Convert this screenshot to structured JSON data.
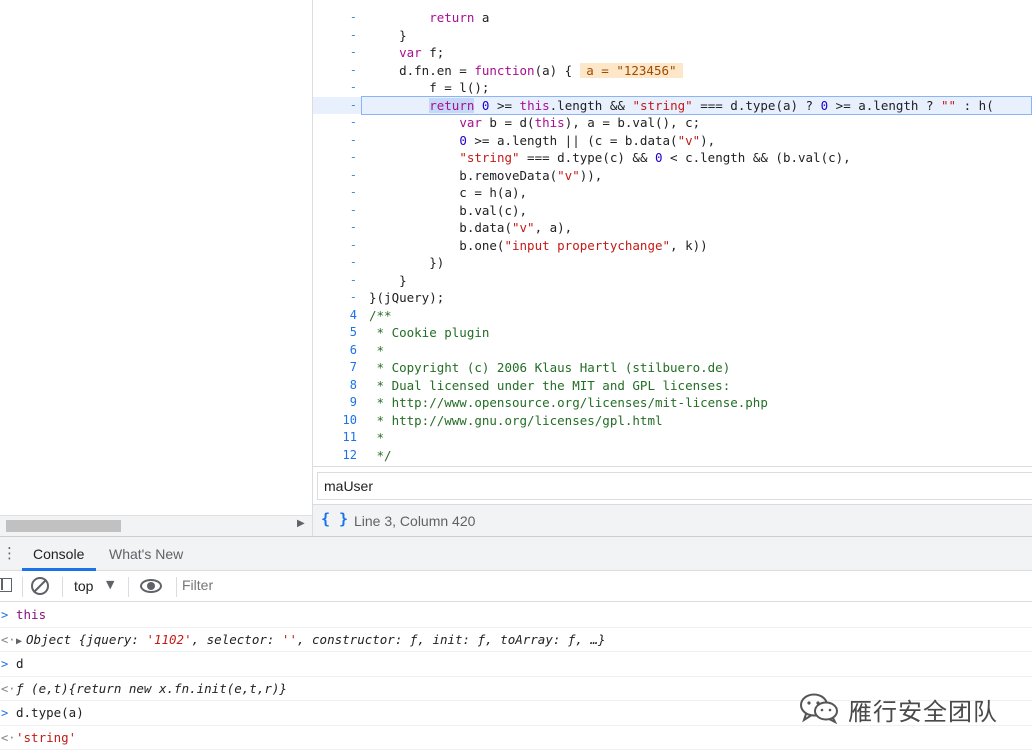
{
  "editor": {
    "lines": [
      {
        "ln": "-",
        "parts": [
          {
            "t": "        ",
            "c": ""
          },
          {
            "t": "return",
            "c": "kw2"
          },
          {
            "t": " a",
            "c": ""
          }
        ]
      },
      {
        "ln": "-",
        "parts": [
          {
            "t": "    }",
            "c": ""
          }
        ]
      },
      {
        "ln": "-",
        "parts": [
          {
            "t": "    ",
            "c": ""
          },
          {
            "t": "var",
            "c": "kw2"
          },
          {
            "t": " f;",
            "c": ""
          }
        ]
      },
      {
        "ln": "-",
        "parts": [
          {
            "t": "    d.fn.en = ",
            "c": ""
          },
          {
            "t": "function",
            "c": "kw2"
          },
          {
            "t": "(a) {",
            "c": ""
          }
        ],
        "inline_value": "a = \"123456\""
      },
      {
        "ln": "-",
        "parts": [
          {
            "t": "        f = l();",
            "c": ""
          }
        ]
      },
      {
        "ln": "-",
        "current": true,
        "parts": [
          {
            "t": "        ",
            "c": ""
          },
          {
            "t": "return",
            "c": "kw2 sel"
          },
          {
            "t": " ",
            "c": ""
          },
          {
            "t": "0",
            "c": "num"
          },
          {
            "t": " >= ",
            "c": ""
          },
          {
            "t": "this",
            "c": "kw2"
          },
          {
            "t": ".length && ",
            "c": ""
          },
          {
            "t": "\"string\"",
            "c": "str"
          },
          {
            "t": " === d.type(a) ? ",
            "c": ""
          },
          {
            "t": "0",
            "c": "num"
          },
          {
            "t": " >= a.length ? ",
            "c": ""
          },
          {
            "t": "\"\"",
            "c": "str"
          },
          {
            "t": " : h(",
            "c": ""
          }
        ]
      },
      {
        "ln": "-",
        "parts": [
          {
            "t": "            ",
            "c": ""
          },
          {
            "t": "var",
            "c": "kw2"
          },
          {
            "t": " b = d(",
            "c": ""
          },
          {
            "t": "this",
            "c": "kw2"
          },
          {
            "t": "), a = b.val(), c;",
            "c": ""
          }
        ]
      },
      {
        "ln": "-",
        "parts": [
          {
            "t": "            ",
            "c": ""
          },
          {
            "t": "0",
            "c": "num"
          },
          {
            "t": " >= a.length || (c = b.data(",
            "c": ""
          },
          {
            "t": "\"v\"",
            "c": "str"
          },
          {
            "t": "),",
            "c": ""
          }
        ]
      },
      {
        "ln": "-",
        "parts": [
          {
            "t": "            ",
            "c": ""
          },
          {
            "t": "\"string\"",
            "c": "str"
          },
          {
            "t": " === d.type(c) && ",
            "c": ""
          },
          {
            "t": "0",
            "c": "num"
          },
          {
            "t": " < c.length && (b.val(c),",
            "c": ""
          }
        ]
      },
      {
        "ln": "-",
        "parts": [
          {
            "t": "            b.removeData(",
            "c": ""
          },
          {
            "t": "\"v\"",
            "c": "str"
          },
          {
            "t": ")),",
            "c": ""
          }
        ]
      },
      {
        "ln": "-",
        "parts": [
          {
            "t": "            c = h(a),",
            "c": ""
          }
        ]
      },
      {
        "ln": "-",
        "parts": [
          {
            "t": "            b.val(c),",
            "c": ""
          }
        ]
      },
      {
        "ln": "-",
        "parts": [
          {
            "t": "            b.data(",
            "c": ""
          },
          {
            "t": "\"v\"",
            "c": "str"
          },
          {
            "t": ", a),",
            "c": ""
          }
        ]
      },
      {
        "ln": "-",
        "parts": [
          {
            "t": "            b.one(",
            "c": ""
          },
          {
            "t": "\"input propertychange\"",
            "c": "str"
          },
          {
            "t": ", k))",
            "c": ""
          }
        ]
      },
      {
        "ln": "-",
        "parts": [
          {
            "t": "        })",
            "c": ""
          }
        ]
      },
      {
        "ln": "-",
        "parts": [
          {
            "t": "    }",
            "c": ""
          }
        ]
      },
      {
        "ln": "-",
        "parts": [
          {
            "t": "}(jQuery);",
            "c": ""
          }
        ]
      },
      {
        "ln": "4",
        "parts": [
          {
            "t": "/**",
            "c": "cmt"
          }
        ]
      },
      {
        "ln": "5",
        "parts": [
          {
            "t": " * Cookie plugin",
            "c": "cmt"
          }
        ]
      },
      {
        "ln": "6",
        "parts": [
          {
            "t": " *",
            "c": "cmt"
          }
        ]
      },
      {
        "ln": "7",
        "parts": [
          {
            "t": " * Copyright (c) 2006 Klaus Hartl (stilbuero.de)",
            "c": "cmt"
          }
        ]
      },
      {
        "ln": "8",
        "parts": [
          {
            "t": " * Dual licensed under the MIT and GPL licenses:",
            "c": "cmt"
          }
        ]
      },
      {
        "ln": "9",
        "parts": [
          {
            "t": " * http://www.opensource.org/licenses/mit-license.php",
            "c": "cmt"
          }
        ]
      },
      {
        "ln": "10",
        "parts": [
          {
            "t": " * http://www.gnu.org/licenses/gpl.html",
            "c": "cmt"
          }
        ]
      },
      {
        "ln": "11",
        "parts": [
          {
            "t": " *",
            "c": "cmt"
          }
        ]
      },
      {
        "ln": "12",
        "parts": [
          {
            "t": " */",
            "c": "cmt"
          }
        ]
      }
    ]
  },
  "search": {
    "value": "maUser"
  },
  "status_bar": {
    "pretty_print_glyph": "{ }",
    "cursor_position": "Line 3, Column 420"
  },
  "drawer": {
    "menu_glyph": "⋮",
    "tabs": [
      {
        "label": "Console"
      },
      {
        "label": "What's New"
      }
    ]
  },
  "console_toolbar": {
    "context": "top",
    "context_caret": "▼",
    "filter_placeholder": "Filter"
  },
  "console": {
    "messages": [
      {
        "kind": "input",
        "prompt": ">",
        "parts": [
          {
            "t": "this",
            "c": "cmd-kw"
          }
        ]
      },
      {
        "kind": "output",
        "prompt": "<·",
        "parts": [
          {
            "t": "▶",
            "c": "tri"
          },
          {
            "t": "Object {jquery: ",
            "c": "obj"
          },
          {
            "t": "'1102'",
            "c": "obj obj-str"
          },
          {
            "t": ", selector: ",
            "c": "obj"
          },
          {
            "t": "''",
            "c": "obj obj-str"
          },
          {
            "t": ", constructor: ƒ, init: ƒ, toArray: ƒ, …}",
            "c": "obj"
          }
        ]
      },
      {
        "kind": "input",
        "prompt": ">",
        "parts": [
          {
            "t": "d",
            "c": "cmd"
          }
        ]
      },
      {
        "kind": "output",
        "prompt": "<·",
        "parts": [
          {
            "t": "ƒ (e,t){return new x.fn.init(e,t,r)}",
            "c": "obj"
          }
        ]
      },
      {
        "kind": "input",
        "prompt": ">",
        "parts": [
          {
            "t": "d.type(a)",
            "c": "cmd"
          }
        ]
      },
      {
        "kind": "output",
        "prompt": "<·",
        "parts": [
          {
            "t": "'string'",
            "c": "obj-str"
          }
        ]
      }
    ]
  },
  "watermark": {
    "text": "雁行安全团队",
    "logo_icon": "wechat-logo-icon"
  },
  "left_pane": {
    "scroll_arrow": "▶"
  }
}
